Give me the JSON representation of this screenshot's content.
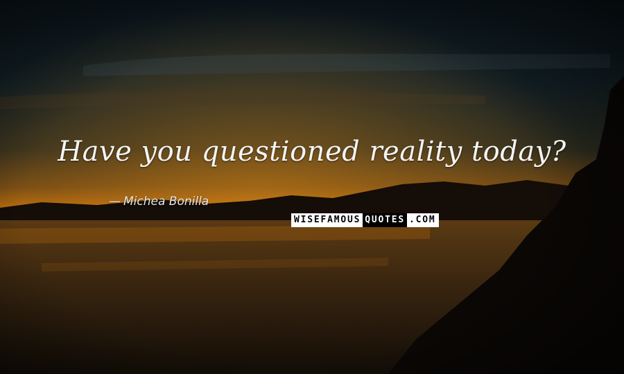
{
  "quote": {
    "text": "Have you questioned reality today?"
  },
  "author": {
    "dash": "—",
    "name": "Michea Bonilla"
  },
  "watermark": {
    "part1": "WISEFAMOUS",
    "part2": "QUOTES",
    "part3": ".COM"
  },
  "colors": {
    "sky_top": "#0d1a20",
    "horizon": "#c0700c",
    "water": "#2a1a08",
    "text": "#f4f4f4"
  }
}
